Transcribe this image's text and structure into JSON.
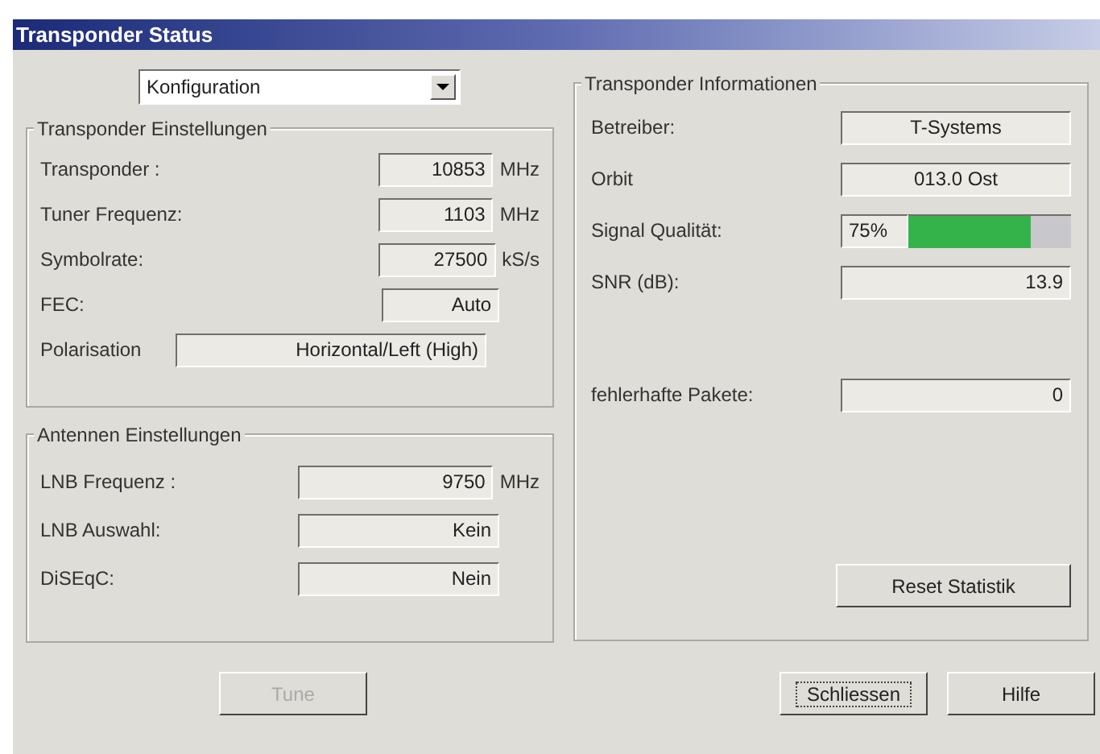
{
  "window": {
    "title": "Transponder Status"
  },
  "dropdown": {
    "value": "Konfiguration"
  },
  "transponder_settings": {
    "title": "Transponder Einstellungen",
    "rows": [
      {
        "kind": "field",
        "label": "Transponder :",
        "value": "10853",
        "unit": "MHz"
      },
      {
        "kind": "field",
        "label": "Tuner Frequenz:",
        "value": "1103",
        "unit": "MHz"
      },
      {
        "kind": "field",
        "label": "Symbolrate:",
        "value": "27500",
        "unit": "kS/s"
      },
      {
        "kind": "field",
        "label": "FEC:",
        "value": "Auto"
      },
      {
        "kind": "wide",
        "label": "Polarisation",
        "value": "Horizontal/Left (High)"
      }
    ]
  },
  "antenna_settings": {
    "title": "Antennen Einstellungen",
    "rows": [
      {
        "label": "LNB Frequenz :",
        "value": "9750",
        "unit": "MHz"
      },
      {
        "label": "LNB Auswahl:",
        "value": "Kein"
      },
      {
        "label": "DiSEqC:",
        "value": "Nein"
      }
    ]
  },
  "transponder_info": {
    "title": "Transponder Informationen",
    "rows": [
      {
        "kind": "centered",
        "label": "Betreiber:",
        "value": "T-Systems"
      },
      {
        "kind": "centered",
        "label": "Orbit",
        "value": "013.0 Ost"
      },
      {
        "kind": "meter",
        "label": "Signal Qualität:",
        "value": "75%",
        "level": 0.75
      },
      {
        "kind": "right",
        "label": "SNR (dB):",
        "value": "13.9"
      }
    ],
    "packet_errors": {
      "label": "fehlerhafte Pakete:",
      "value": "0"
    },
    "reset_button": "Reset Statistik"
  },
  "buttons": [
    {
      "label": "Tune",
      "disabled": true,
      "focused": false
    },
    {
      "label": "Schliessen",
      "disabled": false,
      "focused": true
    },
    {
      "label": "Hilfe",
      "disabled": false,
      "focused": false
    }
  ]
}
